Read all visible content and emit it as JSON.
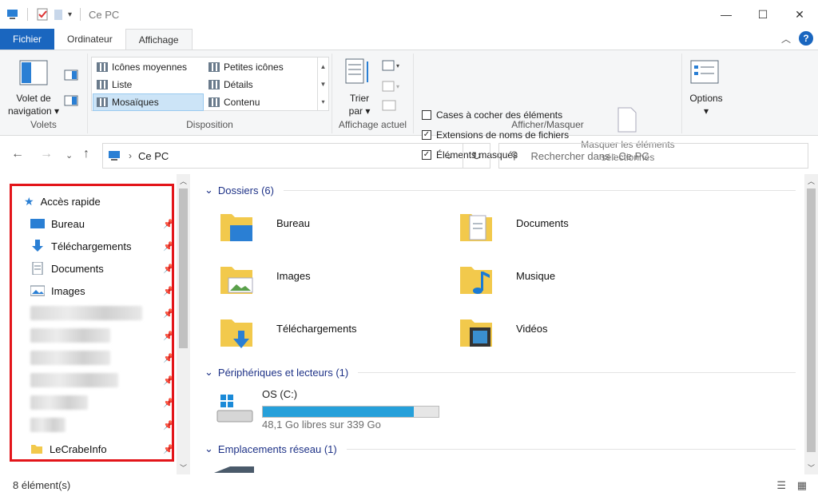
{
  "window": {
    "title": "Ce PC",
    "minimize": "—",
    "maximize": "☐",
    "close": "✕"
  },
  "tabs": [
    {
      "label": "Fichier"
    },
    {
      "label": "Ordinateur"
    },
    {
      "label": "Affichage"
    }
  ],
  "ribbon": {
    "volets": {
      "button_line1": "Volet de",
      "button_line2": "navigation",
      "label": "Volets"
    },
    "disposition": {
      "items": [
        "Icônes moyennes",
        "Petites icônes",
        "Liste",
        "Détails",
        "Mosaïques",
        "Contenu"
      ],
      "selected": "Mosaïques",
      "label": "Disposition"
    },
    "affichage_actuel": {
      "sort_line1": "Trier",
      "sort_line2": "par",
      "label": "Affichage actuel"
    },
    "afficher_masquer": {
      "checkboxes": [
        {
          "label": "Cases à cocher des éléments",
          "checked": false
        },
        {
          "label": "Extensions de noms de fichiers",
          "checked": true
        },
        {
          "label": "Éléments masqués",
          "checked": true
        }
      ],
      "hide_line1": "Masquer les éléments",
      "hide_line2": "sélectionnés",
      "label": "Afficher/Masquer"
    },
    "options": {
      "label": "Options"
    }
  },
  "address": {
    "path": "Ce PC",
    "search_placeholder": "Rechercher dans : Ce PC"
  },
  "nav": {
    "quick_access": "Accès rapide",
    "items": [
      "Bureau",
      "Téléchargements",
      "Documents",
      "Images"
    ],
    "last_item": "LeCrabeInfo"
  },
  "main": {
    "folders_header": "Dossiers (6)",
    "folders": [
      "Bureau",
      "Documents",
      "Images",
      "Musique",
      "Téléchargements",
      "Vidéos"
    ],
    "devices_header": "Périphériques et lecteurs (1)",
    "drive": {
      "name": "OS (C:)",
      "free": "48,1 Go libres sur 339 Go",
      "used_fraction": 0.858
    },
    "network_header": "Emplacements réseau (1)"
  },
  "status": {
    "count": "8 élément(s)"
  },
  "colors": {
    "accent": "#1a66bf",
    "highlight": "#e3151a",
    "drive_fill": "#26a0da"
  }
}
